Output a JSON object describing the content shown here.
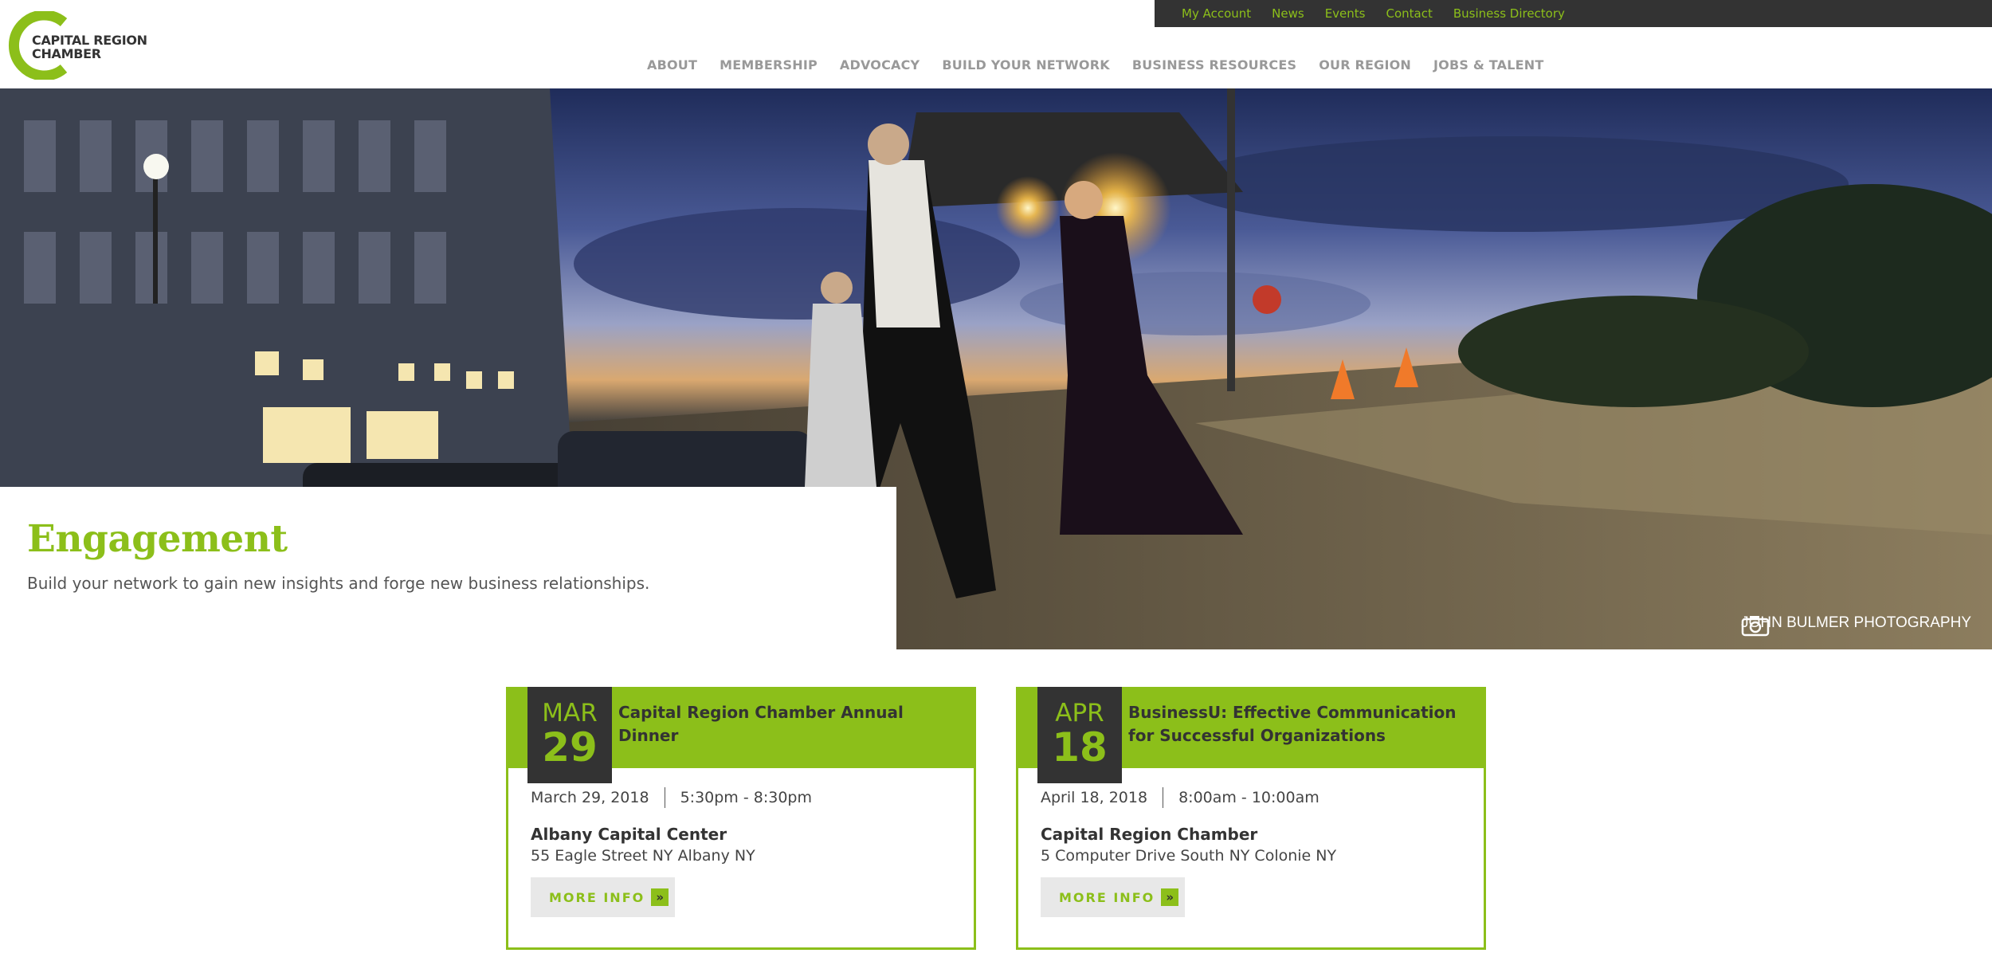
{
  "colors": {
    "brand_green": "#8cbf1a",
    "dark": "#333333",
    "nav_gray": "#999999"
  },
  "logo": {
    "line1": "CAPITAL REGION",
    "line2": "CHAMBER"
  },
  "utility_nav": [
    {
      "label": "My Account"
    },
    {
      "label": "News"
    },
    {
      "label": "Events"
    },
    {
      "label": "Contact"
    },
    {
      "label": "Business Directory"
    }
  ],
  "main_nav": [
    {
      "label": "ABOUT"
    },
    {
      "label": "MEMBERSHIP"
    },
    {
      "label": "ADVOCACY"
    },
    {
      "label": "BUILD YOUR NETWORK"
    },
    {
      "label": "BUSINESS RESOURCES"
    },
    {
      "label": "OUR REGION"
    },
    {
      "label": "JOBS & TALENT"
    }
  ],
  "hero": {
    "title": "Engagement",
    "subtitle": "Build your network to gain new insights and forge new business relationships.",
    "photo_credit": "JOHN BULMER PHOTOGRAPHY",
    "credit_icon": "camera-icon"
  },
  "events": [
    {
      "month": "MAR",
      "day": "29",
      "title": "Capital Region Chamber Annual Dinner",
      "date": "March 29, 2018",
      "time": "5:30pm - 8:30pm",
      "venue": "Albany Capital Center",
      "address": "55 Eagle Street NY Albany NY",
      "button": "MORE INFO",
      "button_icon": "double-chevron-right-icon",
      "button_glyph": "»"
    },
    {
      "month": "APR",
      "day": "18",
      "title": "BusinessU: Effective Communication for Successful Organizations",
      "date": "April 18, 2018",
      "time": "8:00am - 10:00am",
      "venue": "Capital Region Chamber",
      "address": "5 Computer Drive South NY Colonie NY",
      "button": "MORE INFO",
      "button_icon": "double-chevron-right-icon",
      "button_glyph": "»"
    }
  ]
}
